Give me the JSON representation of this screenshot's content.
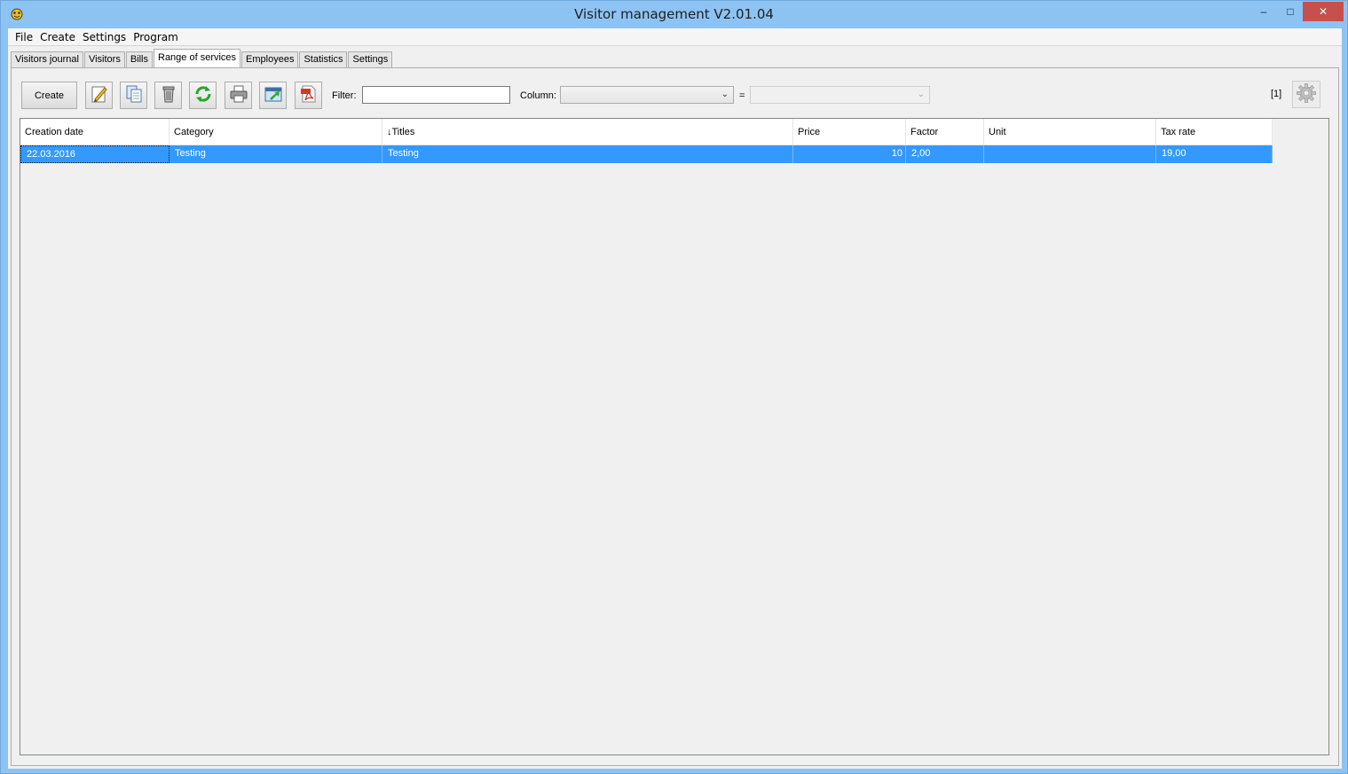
{
  "window": {
    "title": "Visitor management V2.01.04",
    "controls": {
      "minimize": "–",
      "maximize": "□",
      "close": "✕"
    }
  },
  "menu": [
    "File",
    "Create",
    "Settings",
    "Program"
  ],
  "tabs": [
    "Visitors journal",
    "Visitors",
    "Bills",
    "Range of services",
    "Employees",
    "Statistics",
    "Settings"
  ],
  "active_tab": "Range of services",
  "toolbar": {
    "create_label": "Create",
    "tools": [
      "edit-icon",
      "copy-icon",
      "delete-icon",
      "refresh-icon",
      "print-icon",
      "export-icon",
      "pdf-icon"
    ],
    "filter_label": "Filter:",
    "filter_value": "",
    "column_label": "Column:",
    "column_value": "",
    "equals": "=",
    "value_value": "",
    "count": "[1]"
  },
  "table": {
    "columns": [
      "Creation date",
      "Category",
      "↓Titles",
      "Price",
      "Factor",
      "Unit",
      "Tax rate"
    ],
    "rows": [
      [
        "22.03.2016",
        "Testing",
        "Testing",
        "10",
        "2,00",
        "",
        "19,00"
      ]
    ]
  },
  "colors": {
    "titlebar": "#8cc3f3",
    "selection": "#3399ff",
    "close": "#c7504f"
  }
}
